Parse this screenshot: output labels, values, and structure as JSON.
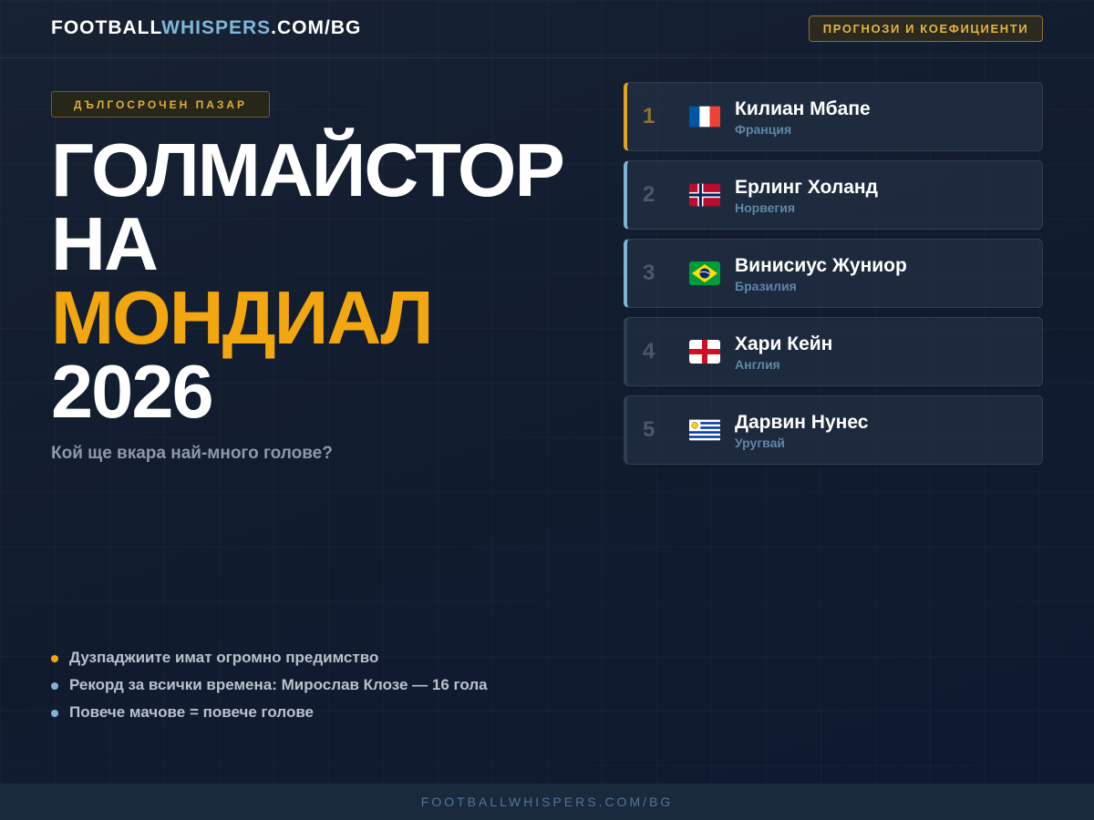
{
  "header": {
    "logo_part1": "FOOTBALL",
    "logo_part2": "WHISPERS",
    "logo_part3": ".COM/BG",
    "cta_label": "ПРОГНОЗИ И КОЕФИЦИЕНТИ"
  },
  "hero": {
    "tag": "ДЪЛГОСРОЧЕН ПАЗАР",
    "title_line1": "ГОЛМАЙСТОР",
    "title_line2": "НА",
    "title_line3": "МОНДИАЛ",
    "title_line4": "2026",
    "subtitle": "Кой ще вкара най-много голове?"
  },
  "ranking": [
    {
      "rank": "1",
      "name": "Килиан Мбапе",
      "country": "Франция",
      "flag": "flag-france-icon"
    },
    {
      "rank": "2",
      "name": "Ерлинг Холанд",
      "country": "Норвегия",
      "flag": "flag-norway-icon"
    },
    {
      "rank": "3",
      "name": "Винисиус Жуниор",
      "country": "Бразилия",
      "flag": "flag-brazil-icon"
    },
    {
      "rank": "4",
      "name": "Хари Кейн",
      "country": "Англия",
      "flag": "flag-england-icon"
    },
    {
      "rank": "5",
      "name": "Дарвин Нунес",
      "country": "Уругвай",
      "flag": "flag-uruguay-icon"
    }
  ],
  "notes": [
    "Дузпаджиите имат огромно предимство",
    "Рекорд за всички времена: Мирослав Клозе — 16 гола",
    "Повече мачове = повече голове"
  ],
  "footer": {
    "text": "FOOTBALLWHISPERS.COM/BG"
  },
  "colors": {
    "accent_gold": "#f2a60f",
    "accent_blue": "#7fb6d9",
    "background": "#0f1a2b"
  }
}
